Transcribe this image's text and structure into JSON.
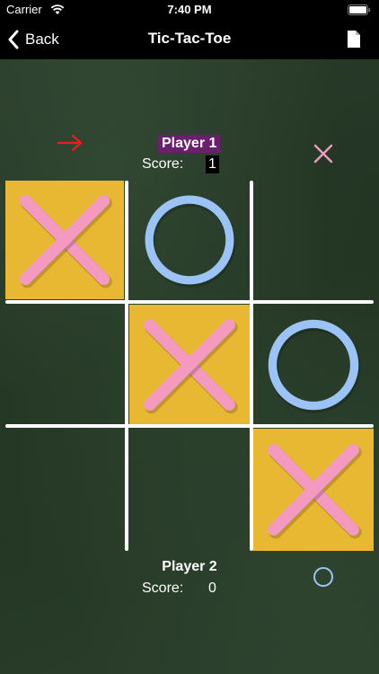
{
  "status_bar": {
    "carrier": "Carrier",
    "time": "7:40 PM"
  },
  "nav": {
    "back_label": "Back",
    "title": "Tic-Tac-Toe",
    "doc_icon": "document-icon"
  },
  "colors": {
    "winning_cell": "#e8b832",
    "x_mark": "#f49ac1",
    "o_mark": "#9cc3f5",
    "player1_highlight": "#6b1f6e",
    "turn_arrow": "#e8201c"
  },
  "player1": {
    "name": "Player 1",
    "score_label": "Score:",
    "score": "1",
    "mark": "X",
    "active_turn": true
  },
  "player2": {
    "name": "Player 2",
    "score_label": "Score:",
    "score": "0",
    "mark": "O"
  },
  "board": {
    "cells": [
      "X",
      "O",
      "",
      "",
      "X",
      "O",
      "",
      "",
      "X"
    ],
    "winning_cells": [
      0,
      4,
      8
    ]
  }
}
